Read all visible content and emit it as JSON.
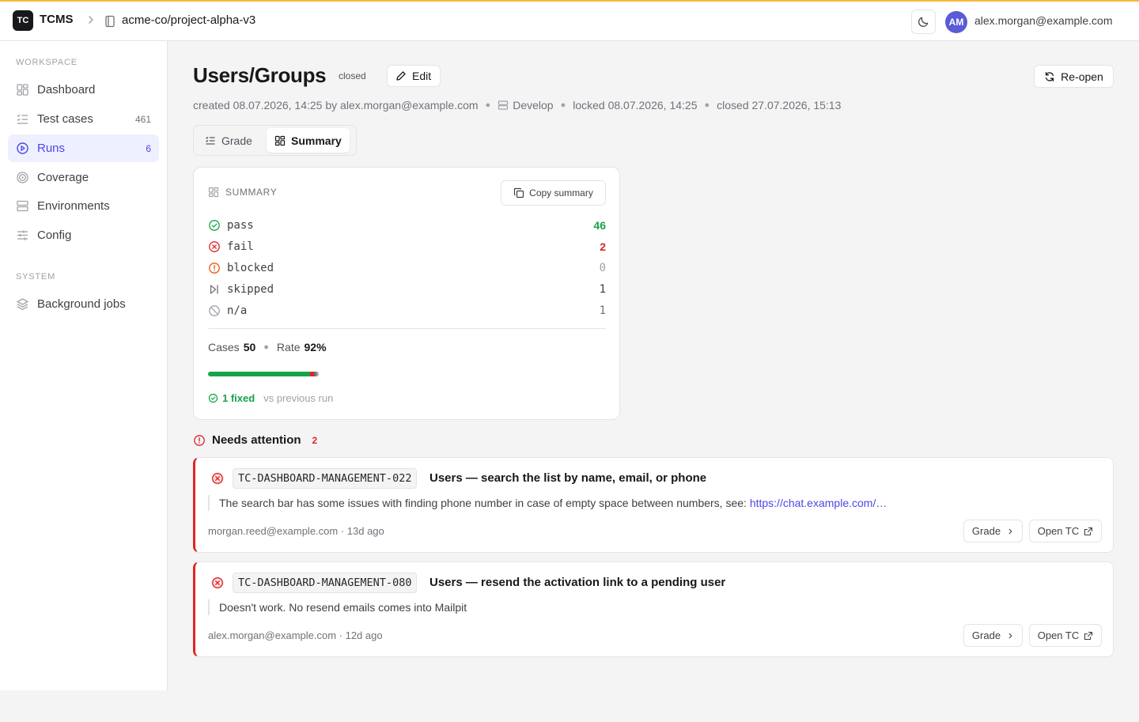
{
  "app": {
    "logo": "TC",
    "name": "TCMS",
    "repo": "acme-co/project-alpha-v3"
  },
  "user": {
    "initials": "AM",
    "email": "alex.morgan@example.com"
  },
  "sidebar": {
    "workspace_label": "WORKSPACE",
    "items": [
      {
        "label": "Dashboard",
        "icon": "dashboard-icon"
      },
      {
        "label": "Test cases",
        "count": "461",
        "icon": "list-check-icon"
      },
      {
        "label": "Runs",
        "count": "6",
        "icon": "play-circle-icon",
        "active": true
      },
      {
        "label": "Coverage",
        "icon": "target-icon"
      },
      {
        "label": "Environments",
        "icon": "server-icon"
      },
      {
        "label": "Config",
        "icon": "sliders-icon"
      }
    ],
    "system_label": "SYSTEM",
    "system_items": [
      {
        "label": "Background jobs",
        "icon": "layers-icon"
      }
    ]
  },
  "page": {
    "title": "Users/Groups",
    "status": "closed",
    "edit_label": "Edit",
    "reopen_label": "Re-open",
    "meta": {
      "created": "created 08.07.2026, 14:25 by alex.morgan@example.com",
      "environment": "Develop",
      "locked": "locked 08.07.2026, 14:25",
      "closed": "closed 27.07.2026, 15:13"
    },
    "tabs": [
      {
        "label": "Grade",
        "icon": "list-check-icon"
      },
      {
        "label": "Summary",
        "icon": "dashboard-icon",
        "active": true
      }
    ]
  },
  "summary": {
    "label": "SUMMARY",
    "copy_label": "Copy summary",
    "stats": [
      {
        "name": "pass",
        "value": "46",
        "color": "#16a34a",
        "icon": "check-circle-icon"
      },
      {
        "name": "fail",
        "value": "2",
        "color": "#dc2626",
        "icon": "x-circle-icon"
      },
      {
        "name": "blocked",
        "value": "0",
        "color": "#a1a1aa",
        "icon": "alert-circle-icon"
      },
      {
        "name": "skipped",
        "value": "1",
        "color": "#3f3f46",
        "icon": "skip-icon"
      },
      {
        "name": "n/a",
        "value": "1",
        "color": "#71717a",
        "icon": "ban-icon"
      }
    ],
    "cases_label": "Cases",
    "cases_value": "50",
    "rate_label": "Rate",
    "rate_value": "92%",
    "bar": [
      {
        "status": "pass",
        "fraction": 0.92,
        "color": "#16a34a"
      },
      {
        "status": "fail",
        "fraction": 0.04,
        "color": "#dc2626"
      },
      {
        "status": "skipped",
        "fraction": 0.02,
        "color": "#71717a"
      },
      {
        "status": "n/a",
        "fraction": 0.02,
        "color": "#a1a1aa"
      }
    ],
    "fixed_label": "1 fixed",
    "fixed_suffix": "vs previous run"
  },
  "attention": {
    "title": "Needs attention",
    "count": "2",
    "items": [
      {
        "code": "TC-DASHBOARD-MANAGEMENT-022",
        "title": "Users — search the list by name, email, or phone",
        "comment": "The search bar has some issues with finding phone number in case of empty space between numbers, see: ",
        "link": "https://chat.example.com/…",
        "author": "morgan.reed@example.com · 13d ago",
        "grade_label": "Grade",
        "open_label": "Open TC"
      },
      {
        "code": "TC-DASHBOARD-MANAGEMENT-080",
        "title": "Users — resend the activation link to a pending user",
        "comment": "Doesn't work. No resend emails comes into Mailpit",
        "link": "",
        "author": "alex.morgan@example.com · 12d ago",
        "grade_label": "Grade",
        "open_label": "Open TC"
      }
    ]
  }
}
